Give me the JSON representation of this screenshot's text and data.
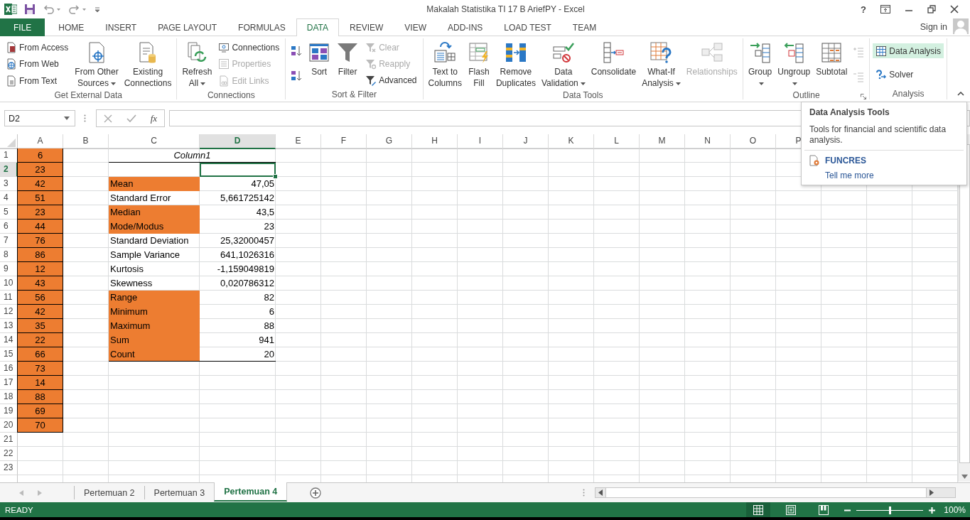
{
  "window": {
    "title": "Makalah Statistika TI 17 B AriefPY - Excel",
    "help_button": "?"
  },
  "ribbon_tabs": [
    {
      "label": "FILE",
      "kind": "file",
      "selected": false
    },
    {
      "label": "HOME",
      "kind": "tab",
      "selected": false
    },
    {
      "label": "INSERT",
      "kind": "tab",
      "selected": false
    },
    {
      "label": "PAGE LAYOUT",
      "kind": "tab",
      "selected": false
    },
    {
      "label": "FORMULAS",
      "kind": "tab",
      "selected": false
    },
    {
      "label": "DATA",
      "kind": "tab",
      "selected": true
    },
    {
      "label": "REVIEW",
      "kind": "tab",
      "selected": false
    },
    {
      "label": "VIEW",
      "kind": "tab",
      "selected": false
    },
    {
      "label": "ADD-INS",
      "kind": "tab",
      "selected": false
    },
    {
      "label": "LOAD TEST",
      "kind": "tab",
      "selected": false
    },
    {
      "label": "TEAM",
      "kind": "tab",
      "selected": false
    }
  ],
  "account": {
    "label": "Sign in"
  },
  "ribbon_groups": [
    {
      "label": "Get External Data",
      "items": [
        {
          "kind": "small",
          "lines": [
            "From Access"
          ],
          "dropdown": false,
          "disabled": false,
          "highlighted": false
        },
        {
          "kind": "small",
          "lines": [
            "From Web"
          ],
          "dropdown": false,
          "disabled": false,
          "highlighted": false
        },
        {
          "kind": "small",
          "lines": [
            "From Text"
          ],
          "dropdown": false,
          "disabled": false,
          "highlighted": false
        },
        {
          "kind": "large",
          "lines": [
            "From Other",
            "Sources"
          ],
          "dropdown": true,
          "disabled": false,
          "highlighted": false
        },
        {
          "kind": "large",
          "lines": [
            "Existing",
            "Connections"
          ],
          "dropdown": false,
          "disabled": false,
          "highlighted": false
        }
      ]
    },
    {
      "label": "Connections",
      "items": [
        {
          "kind": "large",
          "lines": [
            "Refresh",
            "All"
          ],
          "dropdown": true,
          "disabled": false,
          "highlighted": false
        },
        {
          "kind": "small",
          "lines": [
            "Connections"
          ],
          "dropdown": false,
          "disabled": false,
          "highlighted": false
        },
        {
          "kind": "small",
          "lines": [
            "Properties"
          ],
          "dropdown": false,
          "disabled": true,
          "highlighted": false
        },
        {
          "kind": "small",
          "lines": [
            "Edit Links"
          ],
          "dropdown": false,
          "disabled": true,
          "highlighted": false
        }
      ]
    },
    {
      "label": "Sort & Filter",
      "items": [
        {
          "kind": "mini",
          "dropdown": false,
          "disabled": false,
          "highlighted": false
        },
        {
          "kind": "mini",
          "dropdown": false,
          "disabled": false,
          "highlighted": false
        },
        {
          "kind": "large",
          "lines": [
            "Sort"
          ],
          "dropdown": false,
          "disabled": false,
          "highlighted": false
        },
        {
          "kind": "large",
          "lines": [
            "Filter"
          ],
          "dropdown": false,
          "disabled": false,
          "highlighted": false
        },
        {
          "kind": "small",
          "lines": [
            "Clear"
          ],
          "dropdown": false,
          "disabled": true,
          "highlighted": false
        },
        {
          "kind": "small",
          "lines": [
            "Reapply"
          ],
          "dropdown": false,
          "disabled": true,
          "highlighted": false
        },
        {
          "kind": "small",
          "lines": [
            "Advanced"
          ],
          "dropdown": false,
          "disabled": false,
          "highlighted": false
        }
      ]
    },
    {
      "label": "Data Tools",
      "items": [
        {
          "kind": "large",
          "lines": [
            "Text to",
            "Columns"
          ],
          "dropdown": false,
          "disabled": false,
          "highlighted": false
        },
        {
          "kind": "large",
          "lines": [
            "Flash",
            "Fill"
          ],
          "dropdown": false,
          "disabled": false,
          "highlighted": false
        },
        {
          "kind": "large",
          "lines": [
            "Remove",
            "Duplicates"
          ],
          "dropdown": false,
          "disabled": false,
          "highlighted": false
        },
        {
          "kind": "large",
          "lines": [
            "Data",
            "Validation"
          ],
          "dropdown": true,
          "disabled": false,
          "highlighted": false
        },
        {
          "kind": "large",
          "lines": [
            "Consolidate"
          ],
          "dropdown": false,
          "disabled": false,
          "highlighted": false
        },
        {
          "kind": "large",
          "lines": [
            "What-If",
            "Analysis"
          ],
          "dropdown": true,
          "disabled": false,
          "highlighted": false
        },
        {
          "kind": "large",
          "lines": [
            "Relationships"
          ],
          "dropdown": false,
          "disabled": true,
          "highlighted": false
        }
      ]
    },
    {
      "label": "Outline",
      "launcher": true,
      "items": [
        {
          "kind": "large",
          "lines": [
            "Group"
          ],
          "dropdown": true,
          "disabled": false,
          "highlighted": false
        },
        {
          "kind": "large",
          "lines": [
            "Ungroup"
          ],
          "dropdown": true,
          "disabled": false,
          "highlighted": false
        },
        {
          "kind": "large",
          "lines": [
            "Subtotal"
          ],
          "dropdown": false,
          "disabled": false,
          "highlighted": false
        },
        {
          "kind": "mini",
          "dropdown": false,
          "disabled": true,
          "highlighted": false
        },
        {
          "kind": "mini",
          "dropdown": false,
          "disabled": true,
          "highlighted": false
        }
      ]
    },
    {
      "label": "Analysis",
      "items": [
        {
          "kind": "small",
          "lines": [
            "Data Analysis"
          ],
          "dropdown": false,
          "disabled": false,
          "highlighted": true
        },
        {
          "kind": "small",
          "lines": [
            "Solver"
          ],
          "dropdown": false,
          "disabled": false,
          "highlighted": false
        }
      ]
    }
  ],
  "formula_bar": {
    "name_box": "D2",
    "function_label": "fx"
  },
  "tooltip": {
    "title": "Data Analysis Tools",
    "description": "Tools for financial and scientific data analysis.",
    "addin": "FUNCRES",
    "link": "Tell me more"
  },
  "sheet": {
    "columns": [
      {
        "label": "A",
        "selected": false
      },
      {
        "label": "B",
        "selected": false
      },
      {
        "label": "C",
        "selected": false
      },
      {
        "label": "D",
        "selected": true
      },
      {
        "label": "E",
        "selected": false
      },
      {
        "label": "F",
        "selected": false
      },
      {
        "label": "G",
        "selected": false
      },
      {
        "label": "H",
        "selected": false
      },
      {
        "label": "I",
        "selected": false
      },
      {
        "label": "J",
        "selected": false
      },
      {
        "label": "K",
        "selected": false
      },
      {
        "label": "L",
        "selected": false
      },
      {
        "label": "M",
        "selected": false
      },
      {
        "label": "N",
        "selected": false
      },
      {
        "label": "O",
        "selected": false
      },
      {
        "label": "P",
        "selected": false
      }
    ],
    "rows": [
      {
        "label": "1",
        "selected": false,
        "A": {
          "value": "6",
          "highlighted": true,
          "boxed": true
        },
        "C": {
          "value": "Column1",
          "kind": "header",
          "highlighted": false,
          "underlined": true
        }
      },
      {
        "label": "2",
        "selected": true,
        "A": {
          "value": "23",
          "highlighted": true,
          "boxed": true
        }
      },
      {
        "label": "3",
        "selected": false,
        "A": {
          "value": "42",
          "highlighted": true,
          "boxed": true
        },
        "C": {
          "value": "Mean",
          "highlighted": true
        },
        "D": {
          "value": "47,05",
          "highlighted": false
        }
      },
      {
        "label": "4",
        "selected": false,
        "A": {
          "value": "51",
          "highlighted": true,
          "boxed": true
        },
        "C": {
          "value": "Standard Error",
          "highlighted": false
        },
        "D": {
          "value": "5,661725142",
          "highlighted": false
        }
      },
      {
        "label": "5",
        "selected": false,
        "A": {
          "value": "23",
          "highlighted": true,
          "boxed": true
        },
        "C": {
          "value": "Median",
          "highlighted": true
        },
        "D": {
          "value": "43,5",
          "highlighted": false
        }
      },
      {
        "label": "6",
        "selected": false,
        "A": {
          "value": "44",
          "highlighted": true,
          "boxed": true
        },
        "C": {
          "value": "Mode/Modus",
          "highlighted": true
        },
        "D": {
          "value": "23",
          "highlighted": false
        }
      },
      {
        "label": "7",
        "selected": false,
        "A": {
          "value": "76",
          "highlighted": true,
          "boxed": true
        },
        "C": {
          "value": "Standard Deviation",
          "highlighted": false
        },
        "D": {
          "value": "25,32000457",
          "highlighted": false
        }
      },
      {
        "label": "8",
        "selected": false,
        "A": {
          "value": "86",
          "highlighted": true,
          "boxed": true
        },
        "C": {
          "value": "Sample Variance",
          "highlighted": false
        },
        "D": {
          "value": "641,1026316",
          "highlighted": false
        }
      },
      {
        "label": "9",
        "selected": false,
        "A": {
          "value": "12",
          "highlighted": true,
          "boxed": true
        },
        "C": {
          "value": "Kurtosis",
          "highlighted": false
        },
        "D": {
          "value": "-1,159049819",
          "highlighted": false
        }
      },
      {
        "label": "10",
        "selected": false,
        "A": {
          "value": "43",
          "highlighted": true,
          "boxed": true
        },
        "C": {
          "value": "Skewness",
          "highlighted": false
        },
        "D": {
          "value": "0,020786312",
          "highlighted": false
        }
      },
      {
        "label": "11",
        "selected": false,
        "A": {
          "value": "56",
          "highlighted": true,
          "boxed": true
        },
        "C": {
          "value": "Range",
          "highlighted": true
        },
        "D": {
          "value": "82",
          "highlighted": false
        }
      },
      {
        "label": "12",
        "selected": false,
        "A": {
          "value": "42",
          "highlighted": true,
          "boxed": true
        },
        "C": {
          "value": "Minimum",
          "highlighted": true
        },
        "D": {
          "value": "6",
          "highlighted": false
        }
      },
      {
        "label": "13",
        "selected": false,
        "A": {
          "value": "35",
          "highlighted": true,
          "boxed": true
        },
        "C": {
          "value": "Maximum",
          "highlighted": true
        },
        "D": {
          "value": "88",
          "highlighted": false
        }
      },
      {
        "label": "14",
        "selected": false,
        "A": {
          "value": "22",
          "highlighted": true,
          "boxed": true
        },
        "C": {
          "value": "Sum",
          "highlighted": true
        },
        "D": {
          "value": "941",
          "highlighted": false
        }
      },
      {
        "label": "15",
        "selected": false,
        "A": {
          "value": "66",
          "highlighted": true,
          "boxed": true
        },
        "C": {
          "value": "Count",
          "highlighted": true,
          "underlined": true
        },
        "D": {
          "value": "20",
          "highlighted": false,
          "underlined": true
        }
      },
      {
        "label": "16",
        "selected": false,
        "A": {
          "value": "73",
          "highlighted": true,
          "boxed": true
        }
      },
      {
        "label": "17",
        "selected": false,
        "A": {
          "value": "14",
          "highlighted": true,
          "boxed": true
        }
      },
      {
        "label": "18",
        "selected": false,
        "A": {
          "value": "88",
          "highlighted": true,
          "boxed": true
        }
      },
      {
        "label": "19",
        "selected": false,
        "A": {
          "value": "69",
          "highlighted": true,
          "boxed": true
        }
      },
      {
        "label": "20",
        "selected": false,
        "A": {
          "value": "70",
          "highlighted": true,
          "boxed": true
        }
      },
      {
        "label": "21",
        "selected": false
      },
      {
        "label": "22",
        "selected": false
      },
      {
        "label": "23",
        "selected": false
      }
    ]
  },
  "sheet_tabs": [
    {
      "label": "Pertemuan 2",
      "selected": false
    },
    {
      "label": "Pertemuan 3",
      "selected": false
    },
    {
      "label": "Pertemuan 4",
      "selected": true
    }
  ],
  "status_bar": {
    "text": "READY",
    "views": [
      {
        "kind": "normal",
        "selected": true
      },
      {
        "kind": "page-layout",
        "selected": false
      },
      {
        "kind": "page-break",
        "selected": false
      }
    ],
    "zoom": {
      "level": 0.5,
      "reading": "100%"
    }
  }
}
